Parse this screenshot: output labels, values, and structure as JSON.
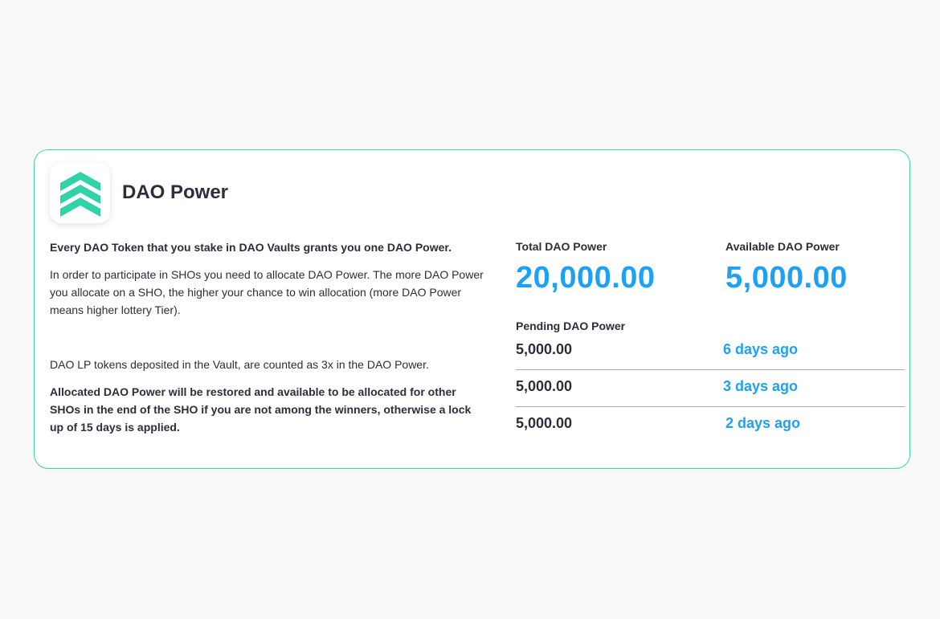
{
  "header": {
    "title": "DAO Power"
  },
  "description": {
    "p1": "Every DAO Token that you stake in DAO Vaults grants you one DAO Power.",
    "p2": "In order to participate in SHOs you need to allocate DAO Power. The more DAO Power you allocate on a SHO, the higher your chance to win allocation (more DAO Power means higher lottery Tier).",
    "p3": "DAO LP tokens deposited in the Vault, are counted as 3x in the DAO Power.",
    "p4": "Allocated DAO Power will be restored and available to be allocated for other SHOs in the end of the SHO if you are not among the winners, otherwise a lock up of 15 days is applied."
  },
  "stats": {
    "total_label": "Total DAO Power",
    "total_value": "20,000.00",
    "available_label": "Available DAO Power",
    "available_value": "5,000.00"
  },
  "pending": {
    "label": "Pending DAO Power",
    "rows": [
      {
        "amount": "5,000.00",
        "time": "6 days ago"
      },
      {
        "amount": "5,000.00",
        "time": "3 days ago"
      },
      {
        "amount": "5,000.00",
        "time": "2 days ago"
      }
    ]
  },
  "colors": {
    "accent": "#1ea1f2",
    "border": "#3fd7a4",
    "logo": "#2ed3a7",
    "text": "#2b2e3b"
  },
  "icons": {
    "logo": "dao-chevrons-logo-icon"
  }
}
